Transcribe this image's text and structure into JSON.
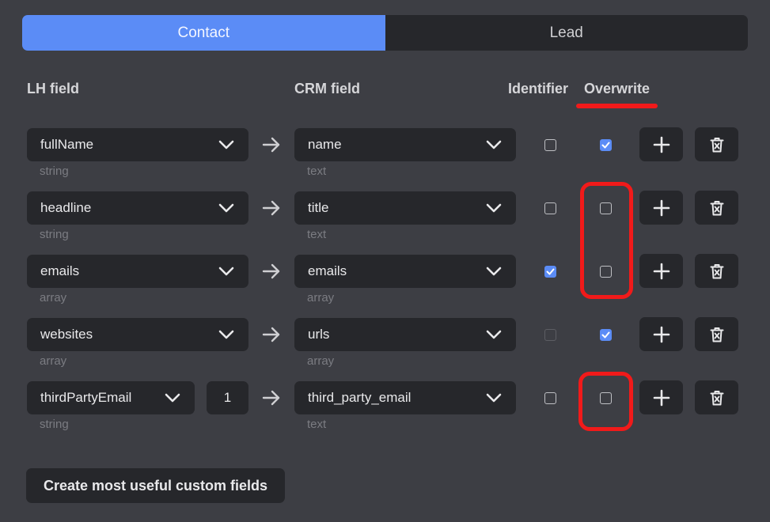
{
  "tabs": [
    {
      "label": "Contact",
      "active": true
    },
    {
      "label": "Lead",
      "active": false
    }
  ],
  "headers": {
    "lh_field": "LH field",
    "crm_field": "CRM field",
    "identifier": "Identifier",
    "overwrite": "Overwrite"
  },
  "rows": [
    {
      "lh_field": "fullName",
      "lh_type": "string",
      "crm_field": "name",
      "crm_type": "text",
      "identifier": false,
      "overwrite": true
    },
    {
      "lh_field": "headline",
      "lh_type": "string",
      "crm_field": "title",
      "crm_type": "text",
      "identifier": false,
      "overwrite": false
    },
    {
      "lh_field": "emails",
      "lh_type": "array",
      "crm_field": "emails",
      "crm_type": "array",
      "identifier": true,
      "overwrite": false
    },
    {
      "lh_field": "websites",
      "lh_type": "array",
      "crm_field": "urls",
      "crm_type": "array",
      "identifier": false,
      "identifier_disabled": true,
      "overwrite": true
    },
    {
      "lh_field": "thirdPartyEmail",
      "lh_type": "string",
      "index": "1",
      "crm_field": "third_party_email",
      "crm_type": "text",
      "identifier": false,
      "overwrite": false
    }
  ],
  "bottom_button": "Create most useful custom fields",
  "icons": {
    "dropdown": "chevron-down-icon",
    "mapping": "arrow-right-icon",
    "add": "plus-icon",
    "delete": "trash-icon",
    "check": "check-icon"
  },
  "colors": {
    "accent": "#5b8cf6",
    "annotation": "#f11a1a",
    "panel": "#26272b",
    "background": "#3d3e44"
  }
}
